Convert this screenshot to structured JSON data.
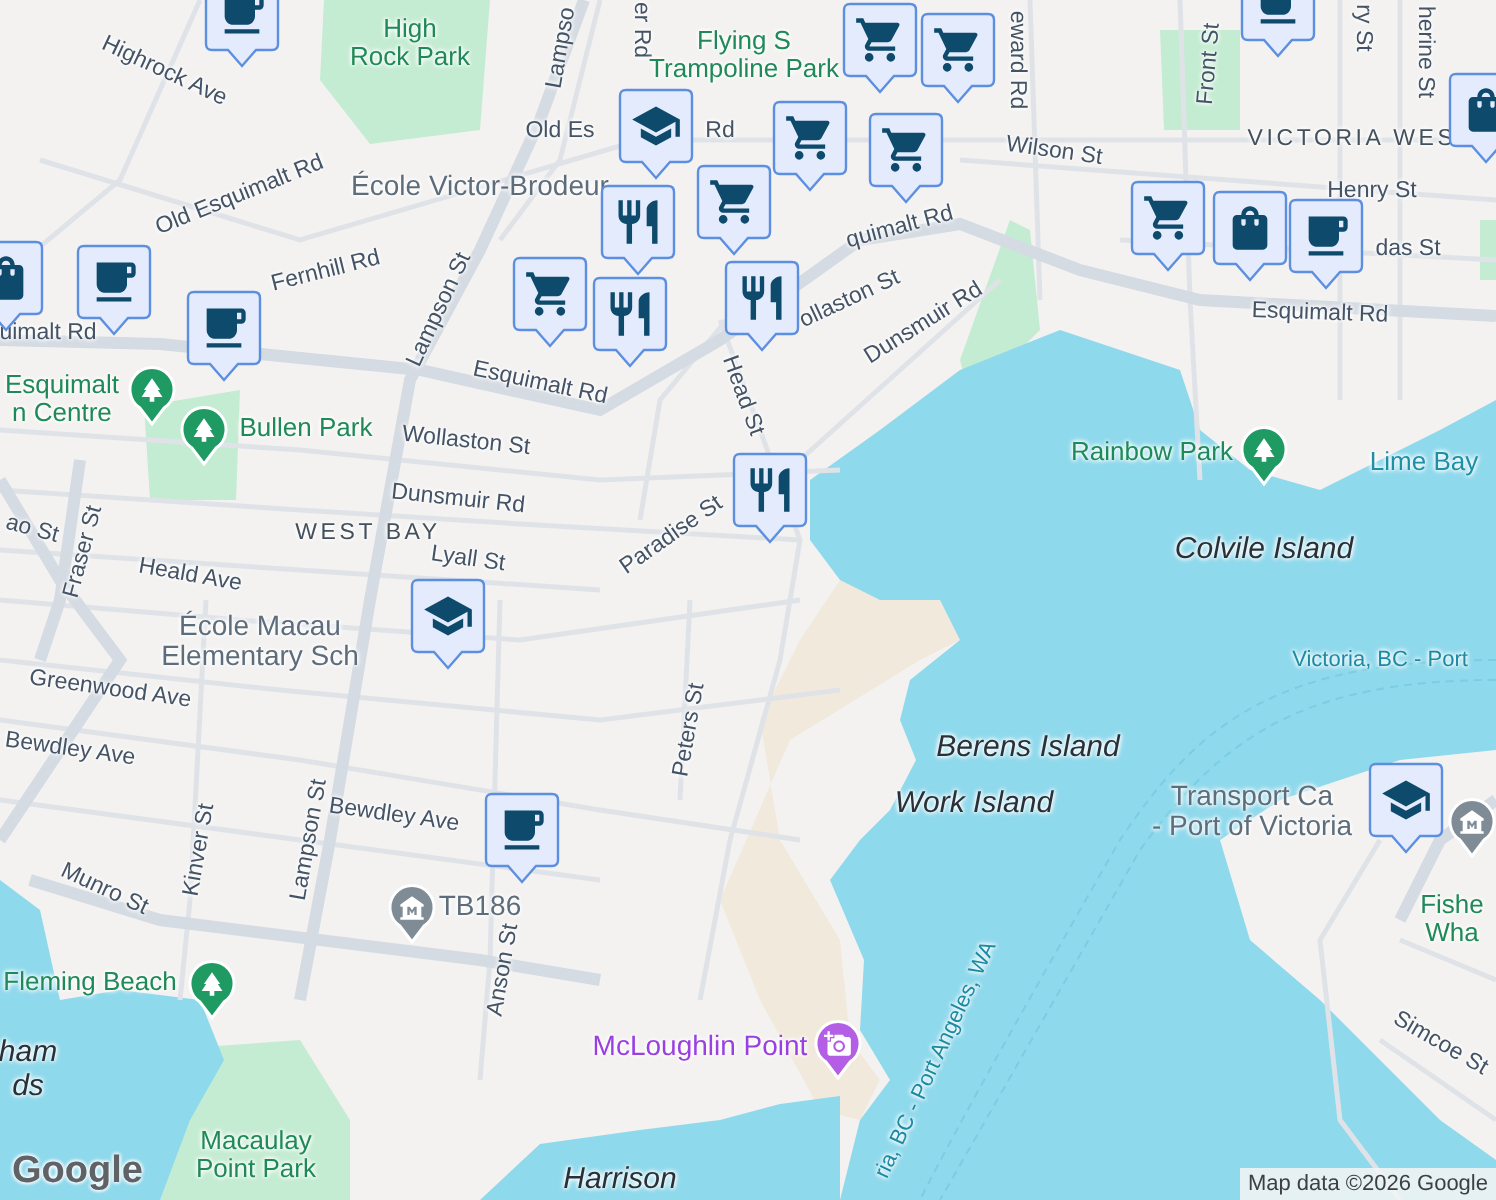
{
  "map": {
    "labels": [
      {
        "kind": "street",
        "lines": [
          "Highrock Ave"
        ]
      },
      {
        "kind": "park",
        "lines": [
          "High",
          "Rock Park"
        ]
      },
      {
        "kind": "street",
        "lines": [
          "er Rd"
        ]
      },
      {
        "kind": "street",
        "lines": [
          "Lampso"
        ]
      },
      {
        "kind": "park",
        "lines": [
          "Flying S",
          "Trampoline Park"
        ]
      },
      {
        "kind": "street",
        "lines": [
          "eward Rd"
        ]
      },
      {
        "kind": "street",
        "lines": [
          "Front St"
        ]
      },
      {
        "kind": "street",
        "lines": [
          "ry St"
        ]
      },
      {
        "kind": "street",
        "lines": [
          "herine St"
        ]
      },
      {
        "kind": "street",
        "lines": [
          "Old Es"
        ]
      },
      {
        "kind": "street",
        "lines": [
          "Rd"
        ]
      },
      {
        "kind": "street",
        "lines": [
          "Old Esquimalt Rd"
        ]
      },
      {
        "kind": "poi",
        "lines": [
          "École Victor-Brodeur"
        ]
      },
      {
        "kind": "area",
        "lines": [
          "VICTORIA WES"
        ]
      },
      {
        "kind": "street",
        "lines": [
          "Wilson St"
        ]
      },
      {
        "kind": "street",
        "lines": [
          "Henry St"
        ]
      },
      {
        "kind": "street",
        "lines": [
          "das St"
        ]
      },
      {
        "kind": "street",
        "lines": [
          "quimalt Rd"
        ]
      },
      {
        "kind": "street",
        "lines": [
          "Fernhill Rd"
        ]
      },
      {
        "kind": "street",
        "lines": [
          "Lampson St"
        ]
      },
      {
        "kind": "street",
        "lines": [
          "uimalt Rd"
        ]
      },
      {
        "kind": "street",
        "lines": [
          "Esquimalt Rd"
        ]
      },
      {
        "kind": "street",
        "lines": [
          "ollaston St"
        ]
      },
      {
        "kind": "street",
        "lines": [
          "Dunsmuir Rd"
        ]
      },
      {
        "kind": "street",
        "lines": [
          "Esquimalt Rd"
        ]
      },
      {
        "kind": "street",
        "lines": [
          "Head St"
        ]
      },
      {
        "kind": "park",
        "lines": [
          "Esquimalt",
          "n Centre"
        ]
      },
      {
        "kind": "park",
        "lines": [
          "Bullen Park"
        ]
      },
      {
        "kind": "street",
        "lines": [
          "Wollaston St"
        ]
      },
      {
        "kind": "street",
        "lines": [
          "Dunsmuir Rd"
        ]
      },
      {
        "kind": "park",
        "lines": [
          "Rainbow Park"
        ]
      },
      {
        "kind": "bay",
        "lines": [
          "Lime Bay"
        ]
      },
      {
        "kind": "street",
        "lines": [
          "ao St"
        ]
      },
      {
        "kind": "area",
        "lines": [
          "WEST BAY"
        ]
      },
      {
        "kind": "street",
        "lines": [
          "Lyall St"
        ]
      },
      {
        "kind": "street",
        "lines": [
          "Fraser St"
        ]
      },
      {
        "kind": "street",
        "lines": [
          "Paradise St"
        ]
      },
      {
        "kind": "island",
        "lines": [
          "Colvile Island"
        ]
      },
      {
        "kind": "street",
        "lines": [
          "Heald Ave"
        ]
      },
      {
        "kind": "poi",
        "lines": [
          "École Macau",
          "Elementary Sch"
        ]
      },
      {
        "kind": "ferry",
        "lines": [
          "Victoria, BC - Port"
        ]
      },
      {
        "kind": "street",
        "lines": [
          "Greenwood Ave"
        ]
      },
      {
        "kind": "street",
        "lines": [
          "Peters St"
        ]
      },
      {
        "kind": "street",
        "lines": [
          "Bewdley Ave"
        ]
      },
      {
        "kind": "island",
        "lines": [
          "Berens Island"
        ]
      },
      {
        "kind": "island",
        "lines": [
          "Work Island"
        ]
      },
      {
        "kind": "poi",
        "lines": [
          "Transport Ca",
          "- Port of Victoria"
        ]
      },
      {
        "kind": "street",
        "lines": [
          "Bewdley Ave"
        ]
      },
      {
        "kind": "street",
        "lines": [
          "Kinver St"
        ]
      },
      {
        "kind": "street",
        "lines": [
          "Lampson St"
        ]
      },
      {
        "kind": "street",
        "lines": [
          "Munro St"
        ]
      },
      {
        "kind": "poi",
        "lines": [
          "TB186"
        ]
      },
      {
        "kind": "park",
        "lines": [
          "Fishe",
          "Wha"
        ]
      },
      {
        "kind": "park",
        "lines": [
          "Fleming Beach"
        ]
      },
      {
        "kind": "street",
        "lines": [
          "Anson St"
        ]
      },
      {
        "kind": "ferry",
        "lines": [
          "ria, BC - Port Angeles, WA"
        ]
      },
      {
        "kind": "street",
        "lines": [
          "Simcoe St"
        ]
      },
      {
        "kind": "island",
        "lines": [
          "ham",
          "ds"
        ]
      },
      {
        "kind": "place",
        "lines": [
          "McLoughlin Point"
        ]
      },
      {
        "kind": "park",
        "lines": [
          "Macaulay",
          "Point Park"
        ]
      },
      {
        "kind": "island",
        "lines": [
          "Harrison"
        ]
      }
    ],
    "markers": [
      {
        "kind": "cafe"
      },
      {
        "kind": "school"
      },
      {
        "kind": "cart"
      },
      {
        "kind": "restaurant"
      },
      {
        "kind": "cart"
      },
      {
        "kind": "cart"
      },
      {
        "kind": "cart"
      },
      {
        "kind": "cart"
      },
      {
        "kind": "restaurant"
      },
      {
        "kind": "cart"
      },
      {
        "kind": "restaurant"
      },
      {
        "kind": "bag"
      },
      {
        "kind": "cafe"
      },
      {
        "kind": "cafe"
      },
      {
        "kind": "restaurant"
      },
      {
        "kind": "cart"
      },
      {
        "kind": "bag"
      },
      {
        "kind": "cafe"
      },
      {
        "kind": "bag"
      },
      {
        "kind": "cafe"
      },
      {
        "kind": "school"
      },
      {
        "kind": "cafe"
      },
      {
        "kind": "school"
      }
    ],
    "pins": [
      {
        "kind": "park"
      },
      {
        "kind": "park"
      },
      {
        "kind": "park"
      },
      {
        "kind": "park"
      },
      {
        "kind": "museum"
      },
      {
        "kind": "camera"
      },
      {
        "kind": "museum"
      }
    ],
    "logo": "Google",
    "attribution": "Map data ©2026 Google"
  }
}
